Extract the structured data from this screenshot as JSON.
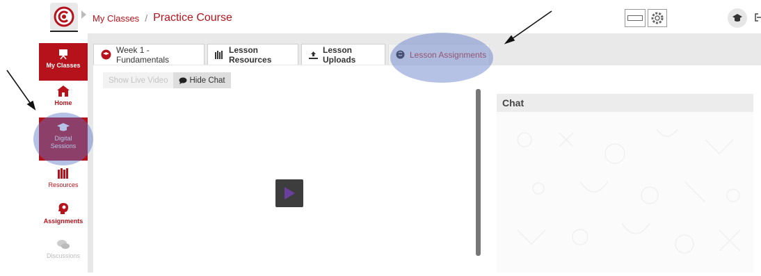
{
  "header": {
    "breadcrumb_root": "My Classes",
    "breadcrumb_sep": "/",
    "breadcrumb_current": "Practice Course"
  },
  "sidebar": {
    "items": [
      {
        "label": "My Classes",
        "icon": "presentation-board-icon",
        "state": "active"
      },
      {
        "label": "Home",
        "icon": "home-icon",
        "state": "normal"
      },
      {
        "label": "Digital Sessions",
        "icon": "graduation-cap-icon",
        "state": "active"
      },
      {
        "label": "Resources",
        "icon": "books-icon",
        "state": "normal"
      },
      {
        "label": "Assignments",
        "icon": "head-gears-icon",
        "state": "normal"
      },
      {
        "label": "Discussions",
        "icon": "chat-bubbles-icon",
        "state": "disabled"
      }
    ]
  },
  "tabs": [
    {
      "label": "Week 1 - Fundamentals",
      "icon": "mortarboard-circle-icon"
    },
    {
      "label": "Lesson Resources",
      "icon": "books-icon"
    },
    {
      "label": "Lesson Uploads",
      "icon": "upload-icon"
    },
    {
      "label": "Lesson Assignments",
      "icon": "brain-icon"
    }
  ],
  "controls": {
    "show_live_video": "Show Live Video",
    "hide_chat": "Hide Chat"
  },
  "chat": {
    "title": "Chat"
  },
  "colors": {
    "brand_red": "#b5121b",
    "highlight": "#5a78c8"
  }
}
